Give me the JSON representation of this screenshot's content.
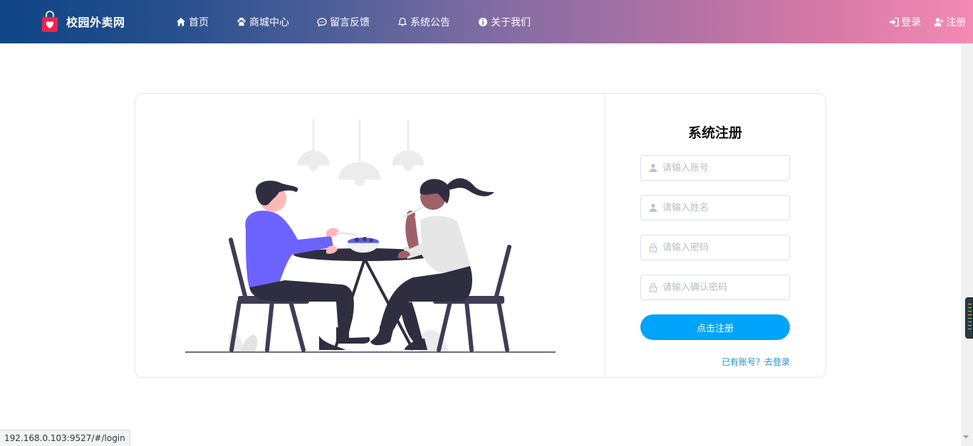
{
  "navbar": {
    "brand_title": "校园外卖网",
    "colors": {
      "gradient_start": "#0e4585",
      "gradient_end": "#f38bb4"
    },
    "menu": [
      {
        "label": "首页",
        "icon": "home-icon"
      },
      {
        "label": "商城中心",
        "icon": "paw-icon"
      },
      {
        "label": "留言反馈",
        "icon": "comment-icon"
      },
      {
        "label": "系统公告",
        "icon": "bell-icon"
      },
      {
        "label": "关于我们",
        "icon": "info-icon"
      }
    ],
    "login_label": "登录",
    "register_label": "注册"
  },
  "register_form": {
    "title": "系统注册",
    "fields": [
      {
        "placeholder": "请输入账号",
        "value": "",
        "icon": "user-icon"
      },
      {
        "placeholder": "请输入姓名",
        "value": "",
        "icon": "user-icon"
      },
      {
        "placeholder": "请输入密码",
        "value": "",
        "icon": "lock-icon"
      },
      {
        "placeholder": "请输入确认密码",
        "value": "",
        "icon": "lock-icon"
      }
    ],
    "submit_label": "点击注册",
    "submit_color": "#01a4fb",
    "login_link": "已有账号？去登录"
  },
  "status_bar": {
    "url": "192.168.0.103:9527/#/login"
  }
}
